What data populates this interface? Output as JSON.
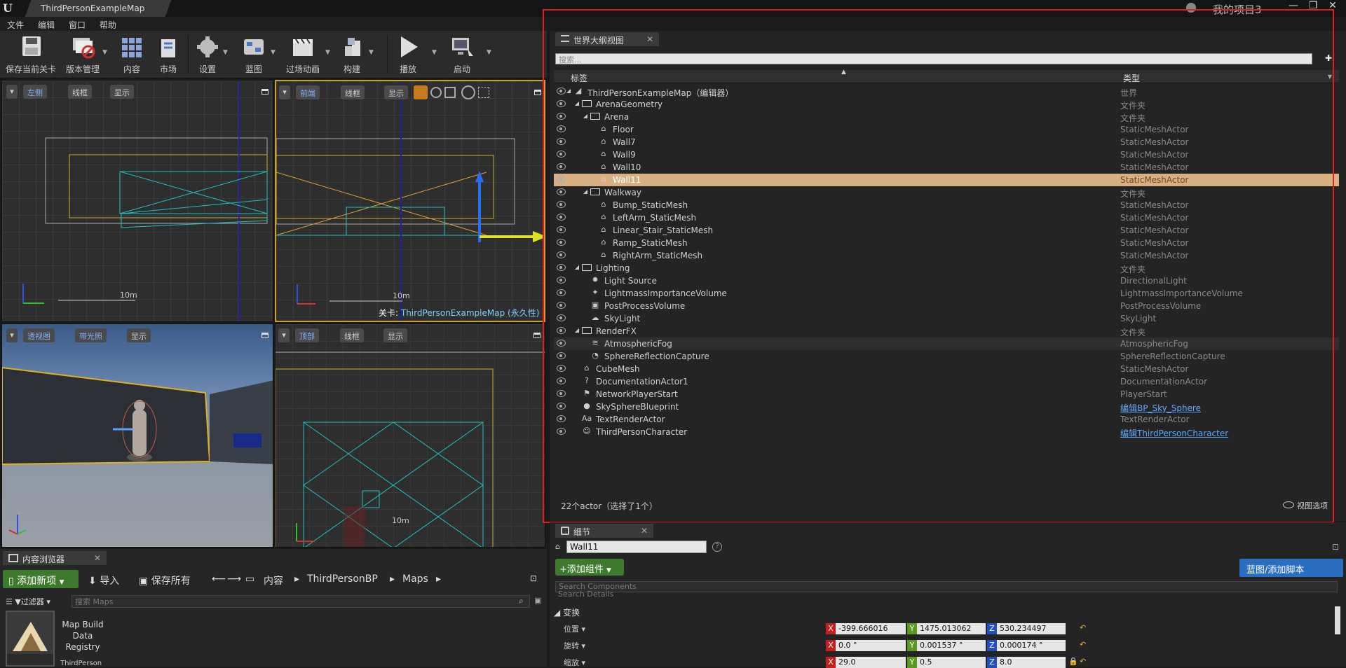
{
  "window": {
    "tab_title": "ThirdPersonExampleMap",
    "project_name": "我的项目3",
    "minimize": "—",
    "restore": "❐",
    "close": "✕"
  },
  "menu": [
    "文件",
    "编辑",
    "窗口",
    "帮助"
  ],
  "toolbar": {
    "buttons": [
      "保存当前关卡",
      "版本管理",
      "内容",
      "市场",
      "设置",
      "蓝图",
      "过场动画",
      "构建",
      "播放",
      "启动"
    ]
  },
  "viewports": {
    "left": {
      "view": "左侧",
      "mode": "线框",
      "show": "显示",
      "scale": "10m"
    },
    "front": {
      "view": "前端",
      "mode": "线框",
      "show": "显示",
      "scale": "10m",
      "level_prefix": "关卡:",
      "level_name": "ThirdPersonExampleMap (永久性)"
    },
    "perspective": {
      "view": "透视图",
      "mode": "带光照",
      "show": "显示"
    },
    "top": {
      "view": "顶部",
      "mode": "线框",
      "show": "显示",
      "scale": "10m"
    }
  },
  "outliner": {
    "tab": "世界大纲视图",
    "search_placeholder": "搜索...",
    "col_label": "标签",
    "col_type": "类型",
    "status": "22个actor（选择了1个）",
    "view_options": "视图选项",
    "rows": [
      {
        "label": "ThirdPersonExampleMap（编辑器）",
        "type": "世界",
        "icon": "world-icon",
        "glyph": "◢"
      },
      {
        "label": "ArenaGeometry",
        "type": "文件夹",
        "icon": "folder-icon",
        "glyph": ""
      },
      {
        "label": "Arena",
        "type": "文件夹",
        "icon": "folder-icon",
        "glyph": ""
      },
      {
        "label": "Floor",
        "type": "StaticMeshActor",
        "icon": "static-mesh-icon",
        "glyph": "⌂"
      },
      {
        "label": "Wall7",
        "type": "StaticMeshActor",
        "icon": "static-mesh-icon",
        "glyph": "⌂"
      },
      {
        "label": "Wall9",
        "type": "StaticMeshActor",
        "icon": "static-mesh-icon",
        "glyph": "⌂"
      },
      {
        "label": "Wall10",
        "type": "StaticMeshActor",
        "icon": "static-mesh-icon",
        "glyph": "⌂"
      },
      {
        "label": "Wall11",
        "type": "StaticMeshActor",
        "icon": "static-mesh-icon",
        "glyph": "⌂"
      },
      {
        "label": "Walkway",
        "type": "文件夹",
        "icon": "folder-icon",
        "glyph": ""
      },
      {
        "label": "Bump_StaticMesh",
        "type": "StaticMeshActor",
        "icon": "static-mesh-icon",
        "glyph": "⌂"
      },
      {
        "label": "LeftArm_StaticMesh",
        "type": "StaticMeshActor",
        "icon": "static-mesh-icon",
        "glyph": "⌂"
      },
      {
        "label": "Linear_Stair_StaticMesh",
        "type": "StaticMeshActor",
        "icon": "static-mesh-icon",
        "glyph": "⌂"
      },
      {
        "label": "Ramp_StaticMesh",
        "type": "StaticMeshActor",
        "icon": "static-mesh-icon",
        "glyph": "⌂"
      },
      {
        "label": "RightArm_StaticMesh",
        "type": "StaticMeshActor",
        "icon": "static-mesh-icon",
        "glyph": "⌂"
      },
      {
        "label": "Lighting",
        "type": "文件夹",
        "icon": "folder-icon",
        "glyph": ""
      },
      {
        "label": "Light Source",
        "type": "DirectionalLight",
        "icon": "directional-light-icon",
        "glyph": "✹"
      },
      {
        "label": "LightmassImportanceVolume",
        "type": "LightmassImportanceVolume",
        "icon": "lightmass-volume-icon",
        "glyph": "✦"
      },
      {
        "label": "PostProcessVolume",
        "type": "PostProcessVolume",
        "icon": "postprocess-volume-icon",
        "glyph": "▣"
      },
      {
        "label": "SkyLight",
        "type": "SkyLight",
        "icon": "skylight-icon",
        "glyph": "☁"
      },
      {
        "label": "RenderFX",
        "type": "文件夹",
        "icon": "folder-icon",
        "glyph": ""
      },
      {
        "label": "AtmosphericFog",
        "type": "AtmosphericFog",
        "icon": "fog-icon",
        "glyph": "≋"
      },
      {
        "label": "SphereReflectionCapture",
        "type": "SphereReflectionCapture",
        "icon": "reflection-capture-icon",
        "glyph": "◔"
      },
      {
        "label": "CubeMesh",
        "type": "StaticMeshActor",
        "icon": "static-mesh-icon",
        "glyph": "⌂"
      },
      {
        "label": "DocumentationActor1",
        "type": "DocumentationActor",
        "icon": "documentation-icon",
        "glyph": "?"
      },
      {
        "label": "NetworkPlayerStart",
        "type": "PlayerStart",
        "icon": "player-start-icon",
        "glyph": "⚑"
      },
      {
        "label": "SkySphereBlueprint",
        "type": "编辑BP_Sky_Sphere",
        "icon": "sphere-icon",
        "glyph": "●"
      },
      {
        "label": "TextRenderActor",
        "type": "TextRenderActor",
        "icon": "text-render-icon",
        "glyph": "Aa"
      },
      {
        "label": "ThirdPersonCharacter",
        "type": "编辑ThirdPersonCharacter",
        "icon": "character-icon",
        "glyph": "☺"
      }
    ]
  },
  "details": {
    "tab": "细节",
    "actor_name": "Wall11",
    "add_component": "+添加组件",
    "blueprint_button": "蓝图/添加脚本",
    "search_components": "Search Components",
    "search_details": "Search Details",
    "section": "变换",
    "location": {
      "label": "位置",
      "x": "-399.666016",
      "y": "1475.013062",
      "z": "530.234497"
    },
    "rotation": {
      "label": "旋转",
      "x": "0.0 °",
      "y": "0.001537 °",
      "z": "0.000174 °"
    },
    "scale": {
      "label": "缩放",
      "x": "29.0",
      "y": "0.5",
      "z": "8.0"
    }
  },
  "content_browser": {
    "tab": "内容浏览器",
    "add_new": "添加新项",
    "import": "导入",
    "save_all": "保存所有",
    "breadcrumb": [
      "内容",
      "ThirdPersonBP",
      "Maps"
    ],
    "filter": "过滤器",
    "search_placeholder": "搜索 Maps",
    "asset_label": "Map Build Data Registry",
    "asset_caption": "ThirdPerson"
  },
  "colors": {
    "selection": "#d8b082",
    "link": "#5ea8ff",
    "add_green": "#3d7a2d",
    "blueprint_blue": "#2a6ec0",
    "highlight_red": "#e02020"
  }
}
